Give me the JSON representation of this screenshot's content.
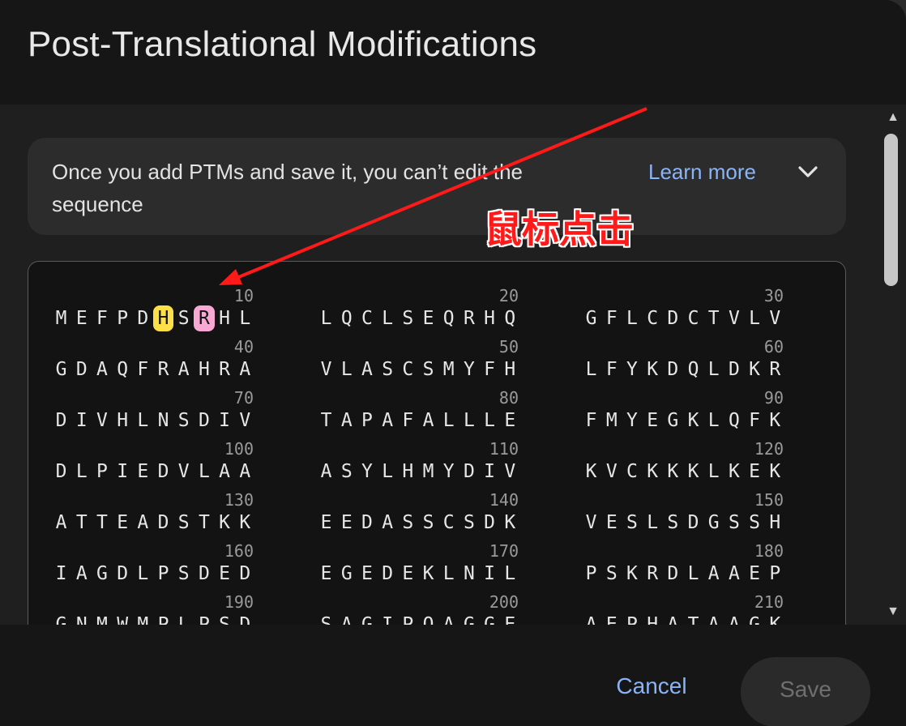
{
  "dialog": {
    "title": "Post-Translational Modifications"
  },
  "info_banner": {
    "text": "Once you add PTMs and save it, you can’t edit the sequence",
    "learn_more": "Learn more",
    "expand_icon": "chevron-down-icon"
  },
  "sequence_rows": [
    [
      {
        "number": "10",
        "residues": "MEFPDHSRHL"
      },
      {
        "number": "20",
        "residues": "LQCLSEQRHQ"
      },
      {
        "number": "30",
        "residues": "GFLCDCTVLV"
      }
    ],
    [
      {
        "number": "40",
        "residues": "GDAQFRAHRA"
      },
      {
        "number": "50",
        "residues": "VLASCSMYFH"
      },
      {
        "number": "60",
        "residues": "LFYKDQLDKR"
      }
    ],
    [
      {
        "number": "70",
        "residues": "DIVHLNSDIV"
      },
      {
        "number": "80",
        "residues": "TAPAFALLLE"
      },
      {
        "number": "90",
        "residues": "FMYEGKLQFK"
      }
    ],
    [
      {
        "number": "100",
        "residues": "DLPIEDVLAA"
      },
      {
        "number": "110",
        "residues": "ASYLHMYDIV"
      },
      {
        "number": "120",
        "residues": "KVCKKKLKEK"
      }
    ],
    [
      {
        "number": "130",
        "residues": "ATTEADSTKK"
      },
      {
        "number": "140",
        "residues": "EEDASSCSDK"
      },
      {
        "number": "150",
        "residues": "VESLSDGSSH"
      }
    ],
    [
      {
        "number": "160",
        "residues": "IAGDLPSDED"
      },
      {
        "number": "170",
        "residues": "EGEDEKLNIL"
      },
      {
        "number": "180",
        "residues": "PSKRDLAAEP"
      }
    ],
    [
      {
        "number": "190",
        "residues": "GNMWMPLPSD"
      },
      {
        "number": "200",
        "residues": "SAGIPQAGGE"
      },
      {
        "number": "210",
        "residues": "AEPHATAAGK"
      }
    ]
  ],
  "highlights": [
    {
      "position": 6,
      "residue": "H",
      "color": "#fde047"
    },
    {
      "position": 8,
      "residue": "R",
      "color": "#f9a8d4"
    }
  ],
  "footer": {
    "cancel_label": "Cancel",
    "save_label": "Save"
  },
  "annotation": {
    "label": "鼠标点击",
    "color": "#ff1a1a"
  },
  "scrollbar": {
    "up_icon": "arrow-up-icon",
    "down_icon": "arrow-down-icon"
  }
}
